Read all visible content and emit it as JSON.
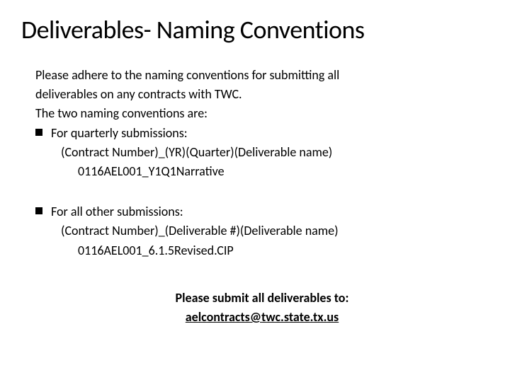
{
  "title": "Deliverables- Naming Conventions",
  "intro": {
    "line1": "Please adhere to the naming conventions for submitting all",
    "line2": "deliverables on any contracts with TWC.",
    "line3": "The two naming conventions are:"
  },
  "bullet1": {
    "label": "For quarterly submissions:",
    "pattern": "(Contract Number)_(YR)(Quarter)(Deliverable name)",
    "example": "0116AEL001_Y1Q1Narrative"
  },
  "bullet2": {
    "label": "For all other submissions:",
    "pattern": "(Contract Number)_(Deliverable #)(Deliverable name)",
    "example": "0116AEL001_6.1.5Revised.CIP"
  },
  "footer": {
    "prompt": "Please submit all deliverables to:",
    "email": "aelcontracts@twc.state.tx.us"
  }
}
